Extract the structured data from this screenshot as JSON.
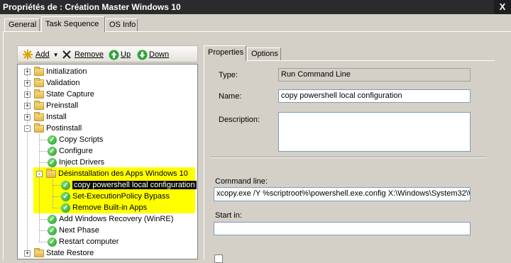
{
  "window": {
    "title": "Propriétés de : Création Master Windows 10",
    "close_label": "X"
  },
  "tabs": [
    "General",
    "Task Sequence",
    "OS Info"
  ],
  "toolbar": {
    "add_label": "Add",
    "remove_label": "Remove",
    "up_label": "Up",
    "down_label": "Down"
  },
  "tree": {
    "nodes": [
      {
        "label": "Initialization",
        "type": "group",
        "expander": "+"
      },
      {
        "label": "Validation",
        "type": "group",
        "expander": "+"
      },
      {
        "label": "State Capture",
        "type": "group",
        "expander": "+"
      },
      {
        "label": "Preinstall",
        "type": "group",
        "expander": "+"
      },
      {
        "label": "Install",
        "type": "group",
        "expander": "+"
      },
      {
        "label": "Postinstall",
        "type": "group",
        "expander": "-"
      },
      {
        "label": "Copy Scripts",
        "type": "step"
      },
      {
        "label": "Configure",
        "type": "step"
      },
      {
        "label": "Inject Drivers",
        "type": "step"
      },
      {
        "label": "Désinstallation des Apps Windows 10",
        "type": "group",
        "expander": "-"
      },
      {
        "label": "copy powershell local configuration",
        "type": "step",
        "selected": true
      },
      {
        "label": "Set-ExecutionPolicy Bypass",
        "type": "step"
      },
      {
        "label": "Remove Built-in Apps",
        "type": "step"
      },
      {
        "label": "Add Windows Recovery (WinRE)",
        "type": "step"
      },
      {
        "label": "Next Phase",
        "type": "step"
      },
      {
        "label": "Restart computer",
        "type": "step"
      },
      {
        "label": "State Restore",
        "type": "group",
        "expander": "+"
      }
    ]
  },
  "properties": {
    "tabs": [
      "Properties",
      "Options"
    ],
    "type_label": "Type:",
    "type_value": "Run Command Line",
    "name_label": "Name:",
    "name_value": "copy powershell local configuration",
    "description_label": "Description:",
    "description_value": "",
    "command_line_label": "Command line:",
    "command_line_value": "xcopy.exe /Y %scriptroot%\\powershell.exe.config X:\\Windows\\System32\\W",
    "start_in_label": "Start in:",
    "start_in_value": ""
  },
  "colors": {
    "titlebar": "#2b2b2b",
    "highlight": "#ffff00",
    "selection": "#0a0a0a",
    "dialog": "#d4d0c8"
  }
}
